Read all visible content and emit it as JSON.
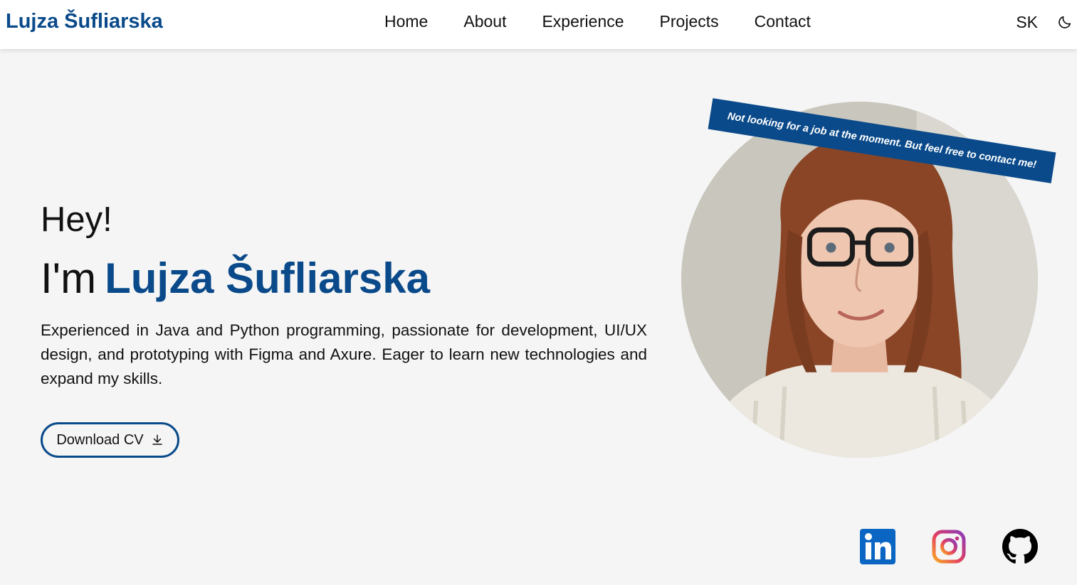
{
  "header": {
    "brand": "Lujza Šufliarska",
    "nav": [
      "Home",
      "About",
      "Experience",
      "Projects",
      "Contact"
    ],
    "language": "SK",
    "theme_icon": "moon-icon"
  },
  "hero": {
    "greeting": "Hey!",
    "intro_prefix": "I'm",
    "name": "Lujza Šufliarska",
    "description": "Experienced in Java and Python programming, passionate for development, UI/UX design, and prototyping with Figma and Axure. Eager to learn new technologies and expand my skills.",
    "cv_button": "Download CV",
    "cv_icon": "download-icon",
    "status_ribbon": "Not looking for a job at the moment. But feel free to contact me!"
  },
  "social": [
    {
      "name": "linkedin-icon"
    },
    {
      "name": "instagram-icon"
    },
    {
      "name": "github-icon"
    }
  ],
  "colors": {
    "accent": "#0a4a8a",
    "background": "#f5f5f5",
    "header_bg": "#ffffff"
  }
}
